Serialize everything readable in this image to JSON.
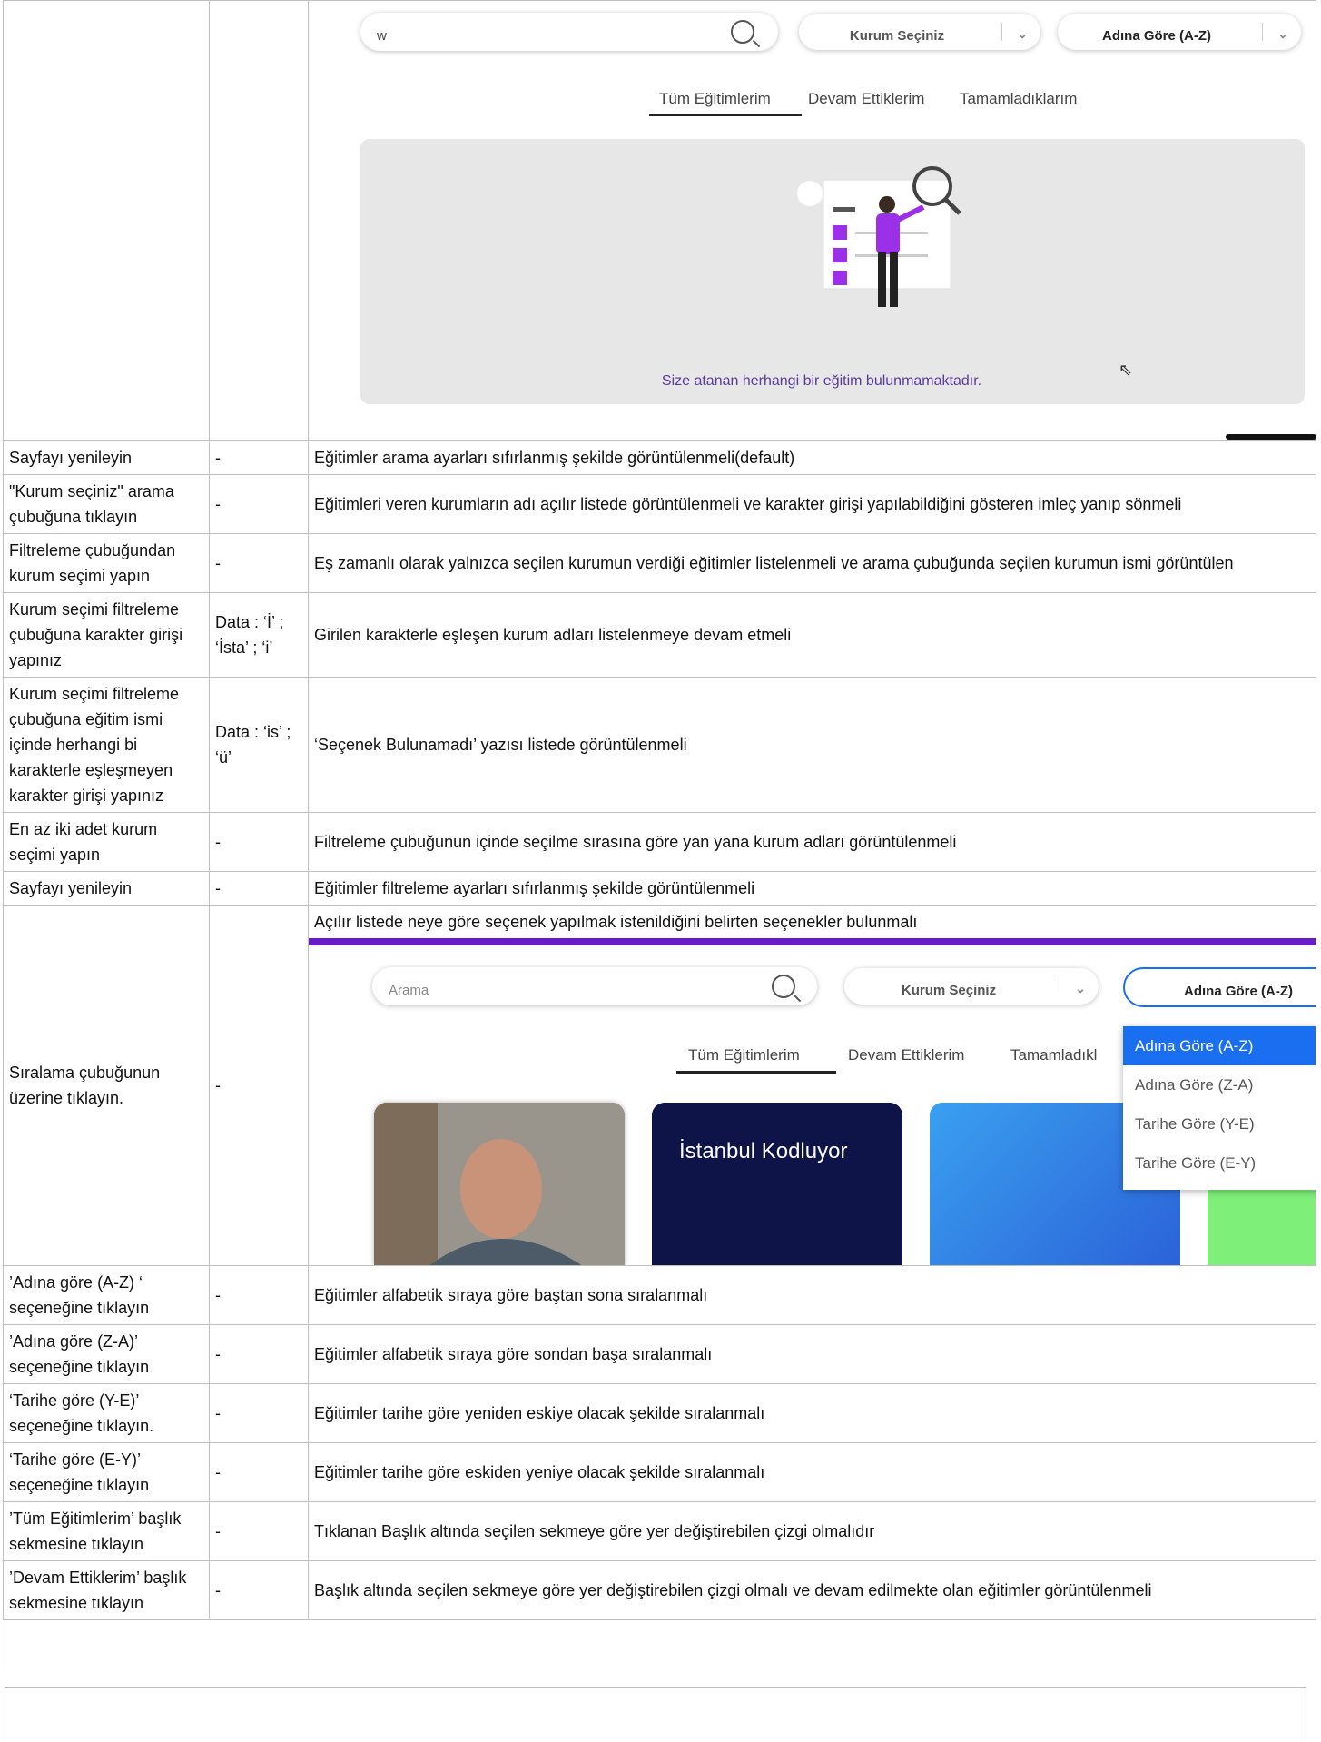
{
  "screenshot1": {
    "search_value": "w",
    "institution_select": "Kurum Seçiniz",
    "sort_select": "Adına Göre (A-Z)",
    "tabs": [
      "Tüm Eğitimlerim",
      "Devam Ettiklerim",
      "Tamamladıklarım"
    ],
    "empty_message": "Size atanan herhangi bir eğitim bulunmamaktadır."
  },
  "screenshot2": {
    "search_placeholder": "Arama",
    "institution_select": "Kurum Seçiniz",
    "sort_select": "Adına Göre (A-Z)",
    "tabs": [
      "Tüm Eğitimlerim",
      "Devam Ettiklerim",
      "Tamamladıkl"
    ],
    "sort_options": [
      "Adına Göre (A-Z)",
      "Adına Göre (Z-A)",
      "Tarihe Göre (Y-E)",
      "Tarihe Göre (E-Y)"
    ],
    "card_title": "İstanbul Kodluyor"
  },
  "rows": [
    {
      "step": "Sayfayı yenileyin",
      "data": "-",
      "expected": "Eğitimler arama ayarları sıfırlanmış şekilde görüntülenmeli(default)"
    },
    {
      "step": "\"Kurum seçiniz\" arama çubuğuna tıklayın",
      "data": "-",
      "expected": "Eğitimleri veren kurumların adı açılır listede görüntülenmeli ve karakter girişi yapılabildiğini gösteren imleç yanıp sönmeli"
    },
    {
      "step": "Filtreleme çubuğundan kurum seçimi yapın",
      "data": "-",
      "expected": "Eş zamanlı olarak yalnızca seçilen kurumun verdiği eğitimler listelenmeli ve arama çubuğunda seçilen kurumun ismi görüntülen"
    },
    {
      "step": "Kurum seçimi filtreleme çubuğuna karakter girişi yapınız",
      "data": "Data : ‘İ’ ; ‘İsta’ ; ‘i’",
      "expected": "Girilen karakterle eşleşen kurum adları listelenmeye devam etmeli"
    },
    {
      "step": "Kurum seçimi filtreleme çubuğuna eğitim ismi içinde herhangi bi karakterle eşleşmeyen karakter girişi yapınız",
      "data": "Data : ‘is’ ; ‘ü’",
      "expected": "‘Seçenek Bulunamadı’ yazısı listede görüntülenmeli"
    },
    {
      "step": "En az iki adet kurum seçimi yapın",
      "data": "-",
      "expected": "Filtreleme çubuğunun içinde seçilme sırasına göre yan yana kurum adları görüntülenmeli"
    },
    {
      "step": "Sayfayı yenileyin",
      "data": "-",
      "expected": "Eğitimler filtreleme ayarları sıfırlanmış şekilde görüntülenmeli"
    },
    {
      "step": "Sıralama çubuğunun üzerine tıklayın.",
      "data": "-",
      "expected": "Açılır listede neye göre seçenek yapılmak istenildiğini belirten seçenekler bulunmalı"
    },
    {
      "step": "’Adına göre (A-Z) ‘ seçeneğine tıklayın",
      "data": "-",
      "expected": "Eğitimler alfabetik sıraya göre baştan sona sıralanmalı"
    },
    {
      "step": "’Adına göre (Z-A)’ seçeneğine tıklayın",
      "data": "-",
      "expected": "Eğitimler alfabetik sıraya göre sondan başa sıralanmalı"
    },
    {
      "step": "‘Tarihe göre (Y-E)’ seçeneğine tıklayın.",
      "data": "-",
      "expected": "Eğitimler tarihe göre yeniden eskiye olacak şekilde sıralanmalı"
    },
    {
      "step": "‘Tarihe göre (E-Y)’ seçeneğine tıklayın",
      "data": "-",
      "expected": "Eğitimler tarihe göre eskiden yeniye olacak şekilde sıralanmalı"
    },
    {
      "step": "’Tüm Eğitimlerim’ başlık sekmesine tıklayın",
      "data": "-",
      "expected": "Tıklanan Başlık altında seçilen sekmeye göre yer değiştirebilen çizgi olmalıdır"
    },
    {
      "step": "’Devam Ettiklerim’ başlık sekmesine tıklayın",
      "data": "-",
      "expected": "Başlık altında seçilen sekmeye göre yer değiştirebilen çizgi olmalı ve devam edilmekte olan eğitimler görüntülenmeli"
    }
  ]
}
